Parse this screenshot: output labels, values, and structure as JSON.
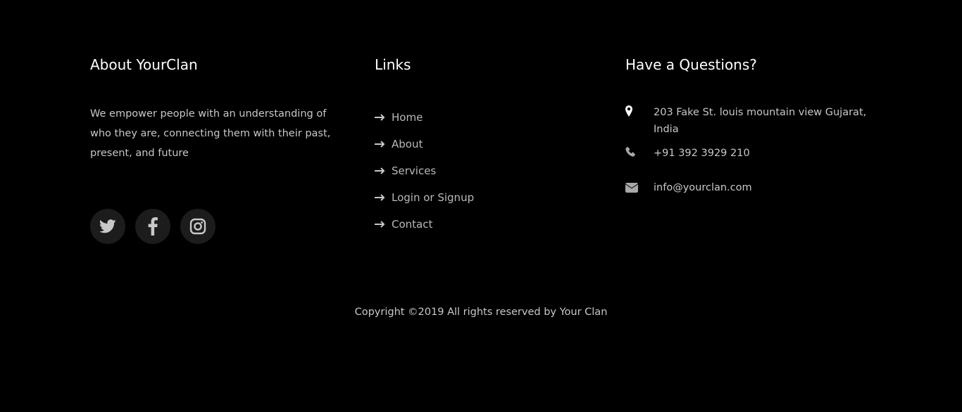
{
  "about": {
    "title": "About YourClan",
    "text": "We empower people with an understanding of who they are, connecting them with their past, present, and future"
  },
  "social": {
    "items": [
      {
        "icon": "twitter-icon"
      },
      {
        "icon": "facebook-icon"
      },
      {
        "icon": "instagram-icon"
      }
    ]
  },
  "links": {
    "title": "Links",
    "items": [
      {
        "label": "Home"
      },
      {
        "label": "About"
      },
      {
        "label": "Services"
      },
      {
        "label": "Login or Signup"
      },
      {
        "label": "Contact"
      }
    ]
  },
  "contact": {
    "title": "Have a Questions?",
    "address": "203 Fake St. louis mountain view Gujarat, India",
    "phone": "+91 392 3929 210",
    "email": "info@yourclan.com"
  },
  "copyright": "Copyright ©2019 All rights reserved by Your Clan",
  "colors": {
    "background": "#000000",
    "heading": "#ffffff",
    "text": "#c8c8c8",
    "social_bg": "#1c1c1c"
  }
}
